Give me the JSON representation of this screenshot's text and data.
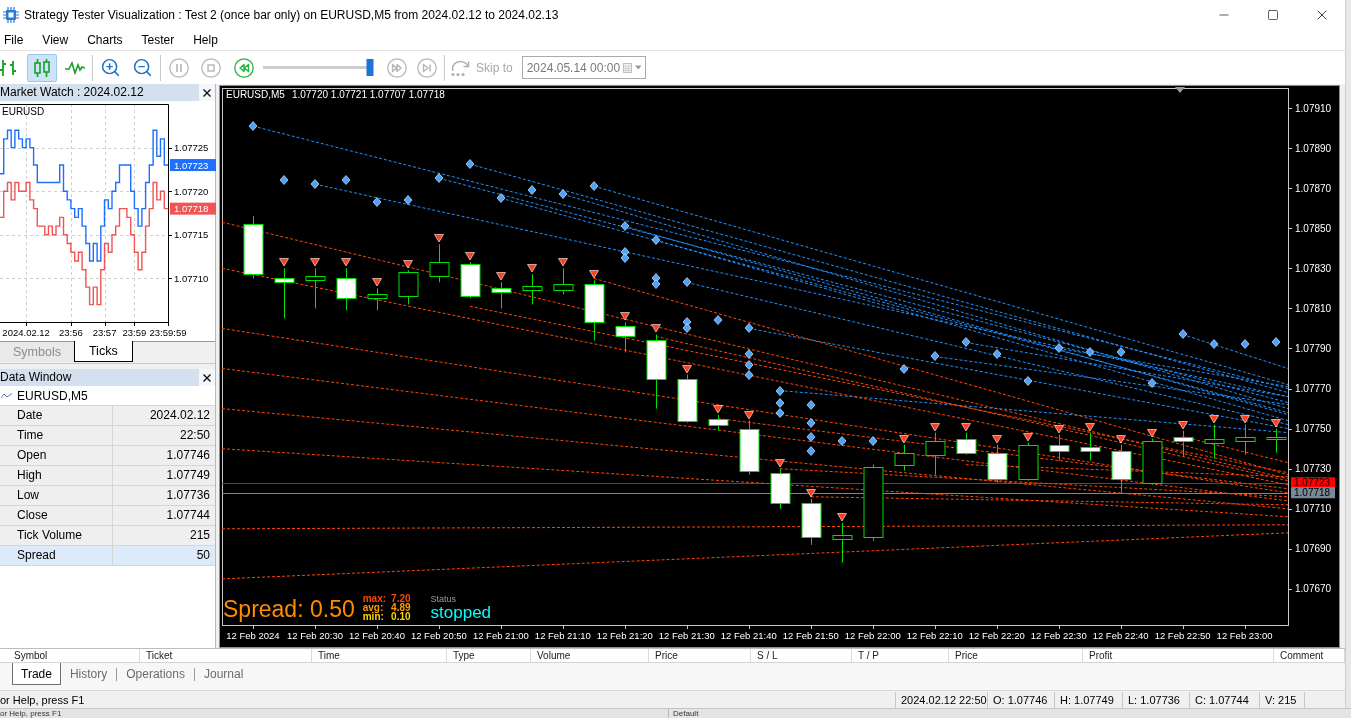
{
  "window": {
    "title": "Strategy Tester Visualization : Test 2 (once bar only) on EURUSD,M5 from 2024.02.12 to 2024.02.13"
  },
  "menu": [
    "File",
    "View",
    "Charts",
    "Tester",
    "Help"
  ],
  "toolbar": {
    "chart_modes": [
      {
        "kind": "bars",
        "selected": false
      },
      {
        "kind": "candles",
        "selected": true
      },
      {
        "kind": "line",
        "selected": false
      }
    ],
    "playback": [
      {
        "kind": "pause",
        "disabled": true
      },
      {
        "kind": "stop",
        "disabled": true
      },
      {
        "kind": "rewind",
        "disabled": false
      }
    ],
    "speed": {
      "level": 0.97
    },
    "stepping": [
      {
        "kind": "fast_forward",
        "disabled": true
      },
      {
        "kind": "skip_end",
        "disabled": true
      }
    ],
    "skip_to": {
      "label": "Skip to",
      "disabled": true,
      "date": "2024.05.14 00:00"
    }
  },
  "market_watch": {
    "title": "Market Watch : 2024.02.12",
    "symbol": "EURUSD",
    "chart_data": {
      "type": "step",
      "categories": [
        null,
        null,
        null,
        null,
        null,
        null,
        null,
        "2024.02.12",
        null,
        null,
        null,
        null,
        null,
        null,
        null,
        null,
        null,
        null,
        null,
        "23:56",
        null,
        null,
        null,
        null,
        null,
        null,
        null,
        null,
        "23:57",
        null,
        null,
        null,
        null,
        null,
        null,
        null,
        "23:59",
        null,
        null,
        null,
        null,
        null,
        null,
        null,
        null,
        "23:59:59"
      ],
      "series": [
        {
          "color": "#1f6fff",
          "values": [
            1.07722,
            1.07726,
            1.07727,
            1.07725,
            1.07727,
            1.07726,
            1.07725,
            1.07726,
            1.07725,
            1.07723,
            1.07721,
            1.07721,
            1.07721,
            1.07721,
            1.07721,
            1.07721,
            1.07723,
            1.0772,
            1.07719,
            1.07718,
            1.07717,
            1.07718,
            1.07716,
            1.07714,
            1.07712,
            1.07714,
            1.07712,
            1.07716,
            1.07719,
            1.07718,
            1.0772,
            1.07721,
            1.07723,
            1.07723,
            1.07723,
            1.0772,
            1.07718,
            1.07716,
            1.07718,
            1.07721,
            1.07723,
            1.07727,
            1.07724,
            1.07726,
            1.07723,
            1.07723
          ]
        },
        {
          "color": "#f05454",
          "values": [
            1.07717,
            1.0772,
            1.07721,
            1.07719,
            1.07721,
            1.0772,
            1.0772,
            1.07721,
            1.07719,
            1.07718,
            1.07716,
            1.07716,
            1.07715,
            1.07716,
            1.07715,
            1.07716,
            1.07717,
            1.07715,
            1.07714,
            1.07713,
            1.07712,
            1.07713,
            1.07711,
            1.07709,
            1.07707,
            1.07709,
            1.07707,
            1.07711,
            1.07714,
            1.07713,
            1.07715,
            1.07716,
            1.07718,
            1.07718,
            1.07717,
            1.07715,
            1.07713,
            1.07711,
            1.07713,
            1.07716,
            1.07718,
            1.07721,
            1.07719,
            1.0772,
            1.07718,
            1.07718
          ]
        }
      ],
      "ylim": [
        1.07705,
        1.0773
      ],
      "yticks": [
        {
          "value": 1.07725,
          "label": "1.07725"
        },
        {
          "value": 1.0772,
          "label": "1.07720"
        },
        {
          "value": 1.07715,
          "label": "1.07715"
        },
        {
          "value": 1.0771,
          "label": "1.07710"
        }
      ],
      "grid": true
    },
    "price_tags": [
      {
        "label": "1.07723",
        "color": "#1f6fff"
      },
      {
        "label": "1.07718",
        "color": "#f05454"
      }
    ],
    "tabs": [
      {
        "label": "Symbols",
        "selected": false
      },
      {
        "label": "Ticks",
        "selected": true
      }
    ]
  },
  "data_window": {
    "title": "Data Window",
    "symbol": "EURUSD,M5",
    "rows": [
      {
        "label": "Date",
        "value": "2024.02.12",
        "selected": false
      },
      {
        "label": "Time",
        "value": "22:50",
        "selected": false
      },
      {
        "label": "Open",
        "value": "1.07746",
        "selected": false
      },
      {
        "label": "High",
        "value": "1.07749",
        "selected": false
      },
      {
        "label": "Low",
        "value": "1.07736",
        "selected": false
      },
      {
        "label": "Close",
        "value": "1.07744",
        "selected": false
      },
      {
        "label": "Tick Volume",
        "value": "215",
        "selected": false
      },
      {
        "label": "Spread",
        "value": "50",
        "selected": true
      }
    ]
  },
  "chart": {
    "symbol": "EURUSD,M5",
    "ohlc_values": "1.07720 1.07721 1.07707 1.07718",
    "chart_data": {
      "type": "candlestick",
      "x": [
        "2024-02-12T20:20",
        "2024-02-12T20:25",
        "2024-02-12T20:30",
        "2024-02-12T20:35",
        "2024-02-12T20:40",
        "2024-02-12T20:45",
        "2024-02-12T20:50",
        "2024-02-12T20:55",
        "2024-02-12T21:00",
        "2024-02-12T21:05",
        "2024-02-12T21:10",
        "2024-02-12T21:15",
        "2024-02-12T21:20",
        "2024-02-12T21:25",
        "2024-02-12T21:30",
        "2024-02-12T21:35",
        "2024-02-12T21:40",
        "2024-02-12T21:45",
        "2024-02-12T21:50",
        "2024-02-12T21:55",
        "2024-02-12T22:00",
        "2024-02-12T22:05",
        "2024-02-12T22:10",
        "2024-02-12T22:15",
        "2024-02-12T22:20",
        "2024-02-12T22:25",
        "2024-02-12T22:30",
        "2024-02-12T22:35",
        "2024-02-12T22:40",
        "2024-02-12T22:45",
        "2024-02-12T22:50",
        "2024-02-12T22:55",
        "2024-02-12T23:00",
        "2024-02-12T23:05"
      ],
      "ohlc": [
        [
          1.07852,
          1.07856,
          1.07825,
          1.07827
        ],
        [
          1.07825,
          1.0783,
          1.07805,
          1.07823
        ],
        [
          1.07824,
          1.0783,
          1.0781,
          1.07826
        ],
        [
          1.07825,
          1.0783,
          1.07809,
          1.07815
        ],
        [
          1.07815,
          1.0782,
          1.07809,
          1.07817
        ],
        [
          1.07816,
          1.07829,
          1.07812,
          1.07828
        ],
        [
          1.07826,
          1.07842,
          1.07823,
          1.07833
        ],
        [
          1.07832,
          1.07833,
          1.07815,
          1.07816
        ],
        [
          1.0782,
          1.07823,
          1.0781,
          1.07818
        ],
        [
          1.07819,
          1.07827,
          1.07812,
          1.07821
        ],
        [
          1.07819,
          1.0783,
          1.07817,
          1.07822
        ],
        [
          1.07822,
          1.07824,
          1.07794,
          1.07803
        ],
        [
          1.07801,
          1.07803,
          1.07788,
          1.07796
        ],
        [
          1.07794,
          1.07797,
          1.0776,
          1.07775
        ],
        [
          1.07775,
          1.07777,
          1.07753,
          1.07754
        ],
        [
          1.07755,
          1.07757,
          1.07749,
          1.07752
        ],
        [
          1.0775,
          1.07754,
          1.07727,
          1.07729
        ],
        [
          1.07728,
          1.0773,
          1.0771,
          1.07713
        ],
        [
          1.07713,
          1.07715,
          1.07692,
          1.07696
        ],
        [
          1.07695,
          1.07703,
          1.07683,
          1.07697
        ],
        [
          1.07696,
          1.07732,
          1.07694,
          1.07731
        ],
        [
          1.07732,
          1.07742,
          1.07729,
          1.07738
        ],
        [
          1.07737,
          1.07748,
          1.07727,
          1.07744
        ],
        [
          1.07745,
          1.07748,
          1.07737,
          1.07738
        ],
        [
          1.07738,
          1.07742,
          1.07723,
          1.07725
        ],
        [
          1.07725,
          1.07743,
          1.07724,
          1.07742
        ],
        [
          1.07742,
          1.07747,
          1.07734,
          1.07739
        ],
        [
          1.07741,
          1.07748,
          1.07734,
          1.07739
        ],
        [
          1.07739,
          1.07742,
          1.07718,
          1.07725
        ],
        [
          1.07723,
          1.07745,
          1.07722,
          1.07744
        ],
        [
          1.07746,
          1.07749,
          1.07736,
          1.07744
        ],
        [
          1.07743,
          1.07752,
          1.07735,
          1.07745
        ],
        [
          1.07744,
          1.07752,
          1.07737,
          1.07746
        ],
        [
          1.07745,
          1.0775,
          1.07738,
          1.07746
        ]
      ],
      "series": [
        {
          "type": "scatter",
          "marker": "diamond",
          "color": "#4aa3ff",
          "values": [
            1.07901,
            1.07874,
            1.07872,
            1.07874,
            1.07863,
            1.07864,
            1.07875,
            1.07882,
            1.07865,
            1.07869,
            1.07867,
            1.07871,
            1.07851,
            1.07844,
            1.07823,
            1.07804,
            1.078,
            1.07769,
            1.07762,
            1.07744,
            1.07744,
            1.0778,
            1.07786,
            1.07793,
            1.07787,
            1.07774,
            1.0779,
            1.07788,
            1.07788,
            1.07773,
            1.07797,
            1.07792,
            1.07792,
            1.07793
          ]
        },
        {
          "type": "scatter",
          "marker": "diamond",
          "color": "#4aa3ff",
          "x": [
            "2024-02-12T21:20",
            "2024-02-12T21:20",
            "2024-02-12T21:25",
            "2024-02-12T21:25",
            "2024-02-12T21:30",
            "2024-02-12T21:30",
            "2024-02-12T21:40",
            "2024-02-12T21:40",
            "2024-02-12T21:40",
            "2024-02-12T21:45",
            "2024-02-12T21:45",
            "2024-02-12T21:50",
            "2024-02-12T21:50",
            "2024-02-12T21:50"
          ],
          "values": [
            1.07838,
            1.07835,
            1.07825,
            1.07822,
            1.07803,
            1.078,
            1.07787,
            1.07782,
            1.07777,
            1.07763,
            1.07758,
            1.07753,
            1.07746,
            1.07739
          ]
        },
        {
          "type": "scatter",
          "marker": "triangle",
          "color": "#ff4020",
          "values": [
            null,
            1.07833,
            1.07833,
            1.07833,
            1.07823,
            1.07832,
            1.07845,
            1.07836,
            1.07826,
            1.0783,
            1.07833,
            1.07827,
            1.07806,
            1.078,
            1.0778,
            1.0776,
            1.07757,
            1.07733,
            1.07718,
            1.07706,
            null,
            1.07745,
            1.07751,
            1.07751,
            1.07745,
            1.07746,
            1.0775,
            1.07751,
            1.07745,
            1.07748,
            1.07752,
            1.07755,
            1.07755,
            1.07753
          ]
        },
        {
          "type": "line",
          "color": "#1e90ff",
          "line_style": "dashed",
          "x": [
            "2024-02-12T20:20",
            "2024-02-12T23:07"
          ],
          "values": [
            1.07901,
            1.0777
          ]
        },
        {
          "type": "line",
          "color": "#1e90ff",
          "line_style": "dashed",
          "x": [
            "2024-02-12T20:30",
            "2024-02-12T23:07"
          ],
          "values": [
            1.07872,
            1.07766
          ]
        },
        {
          "type": "line",
          "color": "#1e90ff",
          "line_style": "dashed",
          "x": [
            "2024-02-12T20:50",
            "2024-02-12T23:07"
          ],
          "values": [
            1.07875,
            1.07763
          ]
        },
        {
          "type": "line",
          "color": "#1e90ff",
          "line_style": "dashed",
          "x": [
            "2024-02-12T20:55",
            "2024-02-12T23:07"
          ],
          "values": [
            1.07882,
            1.07768
          ]
        },
        {
          "type": "line",
          "color": "#1e90ff",
          "line_style": "dashed",
          "x": [
            "2024-02-12T21:00",
            "2024-02-12T23:07"
          ],
          "values": [
            1.07865,
            1.07758
          ]
        },
        {
          "type": "line",
          "color": "#1e90ff",
          "line_style": "dashed",
          "x": [
            "2024-02-12T21:10",
            "2024-02-12T23:07"
          ],
          "values": [
            1.07867,
            1.0776
          ]
        },
        {
          "type": "line",
          "color": "#1e90ff",
          "line_style": "dashed",
          "x": [
            "2024-02-12T21:15",
            "2024-02-12T23:07"
          ],
          "values": [
            1.07871,
            1.07772
          ]
        },
        {
          "type": "line",
          "color": "#1e90ff",
          "line_style": "dashed",
          "x": [
            "2024-02-12T21:20",
            "2024-02-12T23:07"
          ],
          "values": [
            1.07851,
            1.07757
          ]
        },
        {
          "type": "line",
          "color": "#1e90ff",
          "line_style": "dashed",
          "x": [
            "2024-02-12T21:25",
            "2024-02-12T23:07"
          ],
          "values": [
            1.07844,
            1.07754
          ]
        },
        {
          "type": "line",
          "color": "#1e90ff",
          "line_style": "dashed",
          "x": [
            "2024-02-12T21:30",
            "2024-02-12T23:07"
          ],
          "values": [
            1.07823,
            1.07752
          ]
        },
        {
          "type": "line",
          "color": "#1e90ff",
          "line_style": "dashed",
          "x": [
            "2024-02-12T21:40",
            "2024-02-12T23:07"
          ],
          "values": [
            1.078,
            1.0775
          ]
        },
        {
          "type": "line",
          "color": "#1e90ff",
          "line_style": "dashed",
          "x": [
            "2024-02-12T21:45",
            "2024-02-12T23:07"
          ],
          "values": [
            1.07769,
            1.07748
          ]
        },
        {
          "type": "line",
          "color": "#1e90ff",
          "line_style": "dashed",
          "x": [
            "2024-02-12T22:10",
            "2024-02-12T23:07"
          ],
          "values": [
            1.07786,
            1.07762
          ]
        },
        {
          "type": "line",
          "color": "#1e90ff",
          "line_style": "dashed",
          "x": [
            "2024-02-12T22:15",
            "2024-02-12T23:07"
          ],
          "values": [
            1.07793,
            1.07766
          ]
        },
        {
          "type": "line",
          "color": "#1e90ff",
          "line_style": "dashed",
          "x": [
            "2024-02-12T22:30",
            "2024-02-12T23:07"
          ],
          "values": [
            1.0779,
            1.07771
          ]
        },
        {
          "type": "line",
          "color": "#1e90ff",
          "line_style": "dashed",
          "x": [
            "2024-02-12T22:50",
            "2024-02-12T23:07"
          ],
          "values": [
            1.07797,
            1.0778
          ]
        },
        {
          "type": "line",
          "color": "#ff4500",
          "line_style": "dashed",
          "x": [
            "2024-02-12T20:15",
            "2024-02-12T23:07"
          ],
          "values": [
            1.07853,
            1.07725
          ]
        },
        {
          "type": "line",
          "color": "#ff4500",
          "line_style": "dashed",
          "x": [
            "2024-02-12T20:15",
            "2024-02-12T23:07"
          ],
          "values": [
            1.0783,
            1.07722
          ]
        },
        {
          "type": "line",
          "color": "#ff4500",
          "line_style": "dashed",
          "x": [
            "2024-02-12T20:15",
            "2024-02-12T23:07"
          ],
          "values": [
            1.078,
            1.07718
          ]
        },
        {
          "type": "line",
          "color": "#ff4500",
          "line_style": "dashed",
          "x": [
            "2024-02-12T20:15",
            "2024-02-12T23:07"
          ],
          "values": [
            1.0778,
            1.07714
          ]
        },
        {
          "type": "line",
          "color": "#ff4500",
          "line_style": "dashed",
          "x": [
            "2024-02-12T20:15",
            "2024-02-12T23:07"
          ],
          "values": [
            1.0776,
            1.0771
          ]
        },
        {
          "type": "line",
          "color": "#ff4500",
          "line_style": "dashed",
          "x": [
            "2024-02-12T20:15",
            "2024-02-12T23:07"
          ],
          "values": [
            1.0774,
            1.07706
          ]
        },
        {
          "type": "line",
          "color": "#ff4500",
          "line_style": "dashed",
          "x": [
            "2024-02-12T20:15",
            "2024-02-12T23:07"
          ],
          "values": [
            1.077,
            1.07702
          ]
        },
        {
          "type": "line",
          "color": "#ff4500",
          "line_style": "dashed",
          "x": [
            "2024-02-12T20:15",
            "2024-02-12T23:07"
          ],
          "values": [
            1.07675,
            1.07698
          ]
        },
        {
          "type": "line",
          "color": "#ff4500",
          "line_style": "dashed",
          "x": [
            "2024-02-12T20:55",
            "2024-02-12T23:07"
          ],
          "values": [
            1.07811,
            1.07728
          ]
        },
        {
          "type": "line",
          "color": "#ff4500",
          "line_style": "dashed",
          "x": [
            "2024-02-12T21:15",
            "2024-02-12T23:07"
          ],
          "values": [
            1.07825,
            1.07727
          ]
        },
        {
          "type": "line",
          "color": "#ff4500",
          "line_style": "dashed",
          "x": [
            "2024-02-12T21:25",
            "2024-02-12T23:07"
          ],
          "values": [
            1.07796,
            1.07724
          ]
        },
        {
          "type": "line",
          "color": "#ff4500",
          "line_style": "dashed",
          "x": [
            "2024-02-12T21:35",
            "2024-02-12T23:07"
          ],
          "values": [
            1.07755,
            1.0772
          ]
        },
        {
          "type": "line",
          "color": "#ff4500",
          "line_style": "dashed",
          "x": [
            "2024-02-12T21:45",
            "2024-02-12T23:07"
          ],
          "values": [
            1.0773,
            1.07716
          ]
        },
        {
          "type": "line",
          "color": "#ff4500",
          "line_style": "dashed",
          "x": [
            "2024-02-12T21:50",
            "2024-02-12T23:07"
          ],
          "values": [
            1.07716,
            1.07712
          ]
        },
        {
          "type": "line",
          "color": "#ff4500",
          "line_style": "dashed",
          "x": [
            "2024-02-12T22:15",
            "2024-02-12T23:07"
          ],
          "values": [
            1.07732,
            1.07726
          ]
        },
        {
          "type": "line",
          "color": "#ff4500",
          "line_style": "dashed",
          "x": [
            "2024-02-12T22:50",
            "2024-02-12T23:07"
          ],
          "values": [
            1.07746,
            1.07733
          ]
        }
      ],
      "xlim": [
        "2024-02-12T20:15",
        "2024-02-12T23:07"
      ],
      "ylim": [
        1.07652,
        1.0792
      ],
      "xticks": [
        {
          "value": "2024-02-12T20:20",
          "label": "12 Feb 2024"
        },
        {
          "value": "2024-02-12T20:30",
          "label": "12 Feb 20:30"
        },
        {
          "value": "2024-02-12T20:40",
          "label": "12 Feb 20:40"
        },
        {
          "value": "2024-02-12T20:50",
          "label": "12 Feb 20:50"
        },
        {
          "value": "2024-02-12T21:00",
          "label": "12 Feb 21:00"
        },
        {
          "value": "2024-02-12T21:10",
          "label": "12 Feb 21:10"
        },
        {
          "value": "2024-02-12T21:20",
          "label": "12 Feb 21:20"
        },
        {
          "value": "2024-02-12T21:30",
          "label": "12 Feb 21:30"
        },
        {
          "value": "2024-02-12T21:40",
          "label": "12 Feb 21:40"
        },
        {
          "value": "2024-02-12T21:50",
          "label": "12 Feb 21:50"
        },
        {
          "value": "2024-02-12T22:00",
          "label": "12 Feb 22:00"
        },
        {
          "value": "2024-02-12T22:10",
          "label": "12 Feb 22:10"
        },
        {
          "value": "2024-02-12T22:20",
          "label": "12 Feb 22:20"
        },
        {
          "value": "2024-02-12T22:30",
          "label": "12 Feb 22:30"
        },
        {
          "value": "2024-02-12T22:40",
          "label": "12 Feb 22:40"
        },
        {
          "value": "2024-02-12T22:50",
          "label": "12 Feb 22:50"
        },
        {
          "value": "2024-02-12T23:00",
          "label": "12 Feb 23:00"
        }
      ],
      "yticks": [
        {
          "value": 1.0791,
          "label": "1.07910"
        },
        {
          "value": 1.0789,
          "label": "1.07890"
        },
        {
          "value": 1.0787,
          "label": "1.07870"
        },
        {
          "value": 1.0785,
          "label": "1.07850"
        },
        {
          "value": 1.0783,
          "label": "1.07830"
        },
        {
          "value": 1.0781,
          "label": "1.07810"
        },
        {
          "value": 1.0779,
          "label": "1.07790"
        },
        {
          "value": 1.0777,
          "label": "1.07770"
        },
        {
          "value": 1.0775,
          "label": "1.07750"
        },
        {
          "value": 1.0773,
          "label": "1.07730"
        },
        {
          "value": 1.0771,
          "label": "1.07710"
        },
        {
          "value": 1.0769,
          "label": "1.07690"
        },
        {
          "value": 1.0767,
          "label": "1.07670"
        }
      ],
      "ref_lines": [
        {
          "axis": "y",
          "value": 1.07723,
          "label": "1.07723",
          "color": "#ff0000"
        },
        {
          "axis": "y",
          "value": 1.07718,
          "label": "1.07718",
          "color": "#778899"
        }
      ]
    },
    "spread_panel": {
      "title": "Spread: 0.50",
      "stats": [
        {
          "label": "max:",
          "value": "7.20",
          "color": "#ff4500"
        },
        {
          "label": "avg:",
          "value": "4.89",
          "color": "#ff9900"
        },
        {
          "label": "min:",
          "value": "0.10",
          "color": "#ffd700"
        }
      ],
      "status_label": "Status",
      "status": "stopped"
    }
  },
  "toolbox": {
    "columns": [
      "Symbol",
      "Ticket",
      "Time",
      "Type",
      "Volume",
      "Price",
      "S / L",
      "T / P",
      "Price",
      "Profit",
      "Comment"
    ],
    "tabs": [
      {
        "label": "Trade",
        "selected": true
      },
      {
        "label": "History",
        "selected": false
      },
      {
        "label": "Operations",
        "selected": false
      },
      {
        "label": "Journal",
        "selected": false
      }
    ]
  },
  "status_bar": {
    "help": "or Help, press F1",
    "fields": [
      "2024.02.12 22:50",
      "O: 1.07746",
      "H: 1.07749",
      "L: 1.07736",
      "C: 1.07744",
      "V: 215"
    ]
  },
  "background_window": {
    "texts": [
      "or Help, press F1",
      "Default"
    ]
  }
}
